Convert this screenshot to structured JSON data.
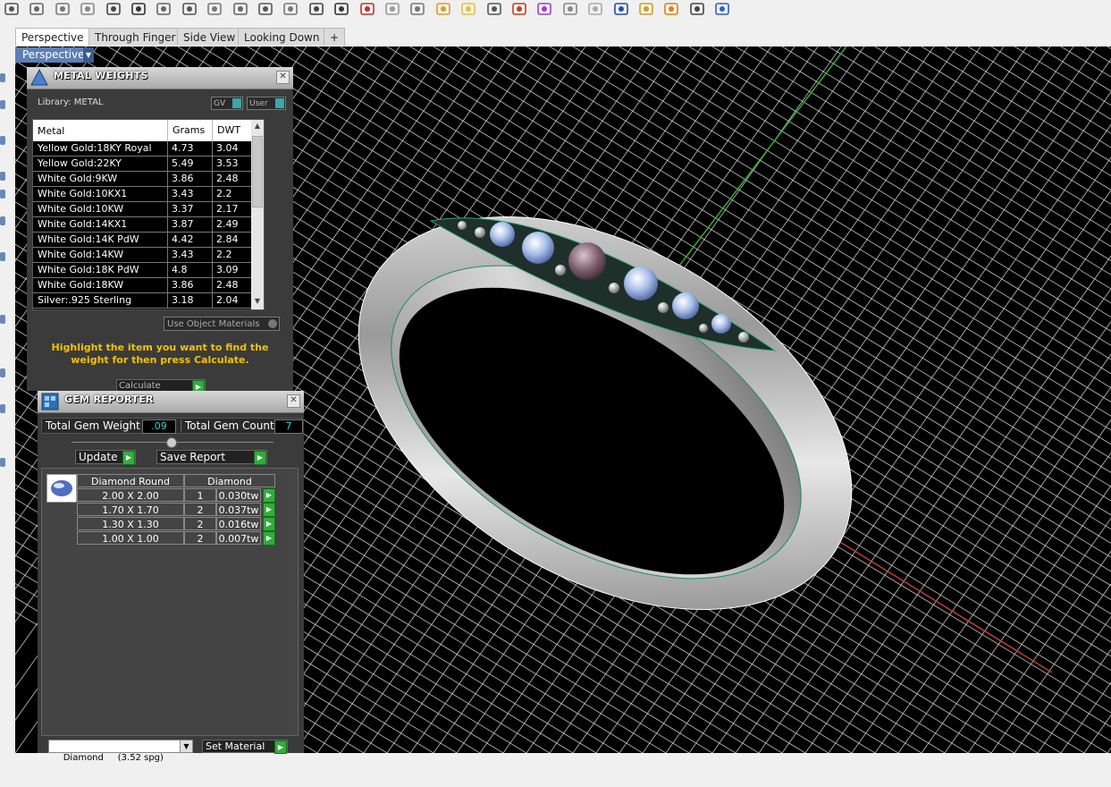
{
  "toolbar": {
    "icons": [
      "print-icon",
      "new-icon",
      "cut-icon",
      "copy-icon",
      "paste-icon",
      "undo-icon",
      "pan-icon",
      "rotate-icon",
      "zoom-icon",
      "zoom-window-icon",
      "zoom-extents-icon",
      "zoom-selected-icon",
      "zoom-target-icon",
      "viewport-layout-icon",
      "car-icon",
      "light-icon",
      "circle-icon",
      "snap-icon",
      "bulb-icon",
      "lock-icon",
      "materials-icon",
      "color-wheel-icon",
      "sphere-gray-icon",
      "sphere-light-icon",
      "sphere-blue-icon",
      "pencil-icon",
      "gear-icon",
      "network-icon",
      "help-icon"
    ]
  },
  "tabs": [
    {
      "label": "Perspective",
      "active": true
    },
    {
      "label": "Through Finger",
      "active": false
    },
    {
      "label": "Side View",
      "active": false
    },
    {
      "label": "Looking Down",
      "active": false
    }
  ],
  "add_tab_label": "+",
  "viewport": {
    "label": "Perspective"
  },
  "metal_weights": {
    "title": "METAL WEIGHTS",
    "library_label": "Library: METAL",
    "gv_label": "GV",
    "user_label": "User",
    "columns": [
      "Metal",
      "Grams",
      "DWT"
    ],
    "rows": [
      {
        "metal": "Yellow Gold:18KY Royal",
        "grams": "4.73",
        "dwt": "3.04"
      },
      {
        "metal": "Yellow Gold:22KY",
        "grams": "5.49",
        "dwt": "3.53"
      },
      {
        "metal": "White Gold:9KW",
        "grams": "3.86",
        "dwt": "2.48"
      },
      {
        "metal": "White Gold:10KX1",
        "grams": "3.43",
        "dwt": "2.2"
      },
      {
        "metal": "White Gold:10KW",
        "grams": "3.37",
        "dwt": "2.17"
      },
      {
        "metal": "White Gold:14KX1",
        "grams": "3.87",
        "dwt": "2.49"
      },
      {
        "metal": "White Gold:14K PdW",
        "grams": "4.42",
        "dwt": "2.84"
      },
      {
        "metal": "White Gold:14KW",
        "grams": "3.43",
        "dwt": "2.2"
      },
      {
        "metal": "White Gold:18K PdW",
        "grams": "4.8",
        "dwt": "3.09"
      },
      {
        "metal": "White Gold:18KW",
        "grams": "3.86",
        "dwt": "2.48"
      },
      {
        "metal": "Silver:.925 Sterling",
        "grams": "3.18",
        "dwt": "2.04"
      }
    ],
    "use_object_materials": "Use Object Materials",
    "instruction": "Highlight the item you want to find the weight for then press Calculate.",
    "calculate_label": "Calculate"
  },
  "gem_reporter": {
    "title": "GEM REPORTER",
    "total_weight_label": "Total Gem Weight",
    "total_weight_value": ".09",
    "total_count_label": "Total Gem Count",
    "total_count_value": "7",
    "update_label": "Update",
    "save_report_label": "Save Report",
    "col_shape": "Diamond Round",
    "col_material": "Diamond",
    "rows": [
      {
        "size": "2.00 X 2.00",
        "count": "1",
        "weight": "0.030tw"
      },
      {
        "size": "1.70 X 1.70",
        "count": "2",
        "weight": "0.037tw"
      },
      {
        "size": "1.30 X 1.30",
        "count": "2",
        "weight": "0.016tw"
      },
      {
        "size": "1.00 X 1.00",
        "count": "2",
        "weight": "0.007tw"
      }
    ],
    "material_select": "Diamond     (3.52 spg)",
    "set_material_label": "Set Material"
  },
  "colors": {
    "viewport_bg": "#000000",
    "grid": "#cfcfcf",
    "panel_bg": "#3b3b3b",
    "accent_yellow": "#f2c200",
    "active_label": "#5d7fb5"
  }
}
